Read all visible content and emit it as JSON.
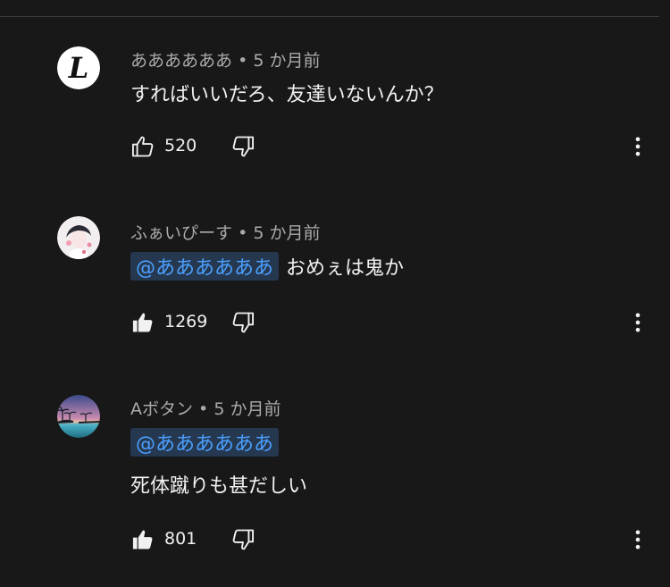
{
  "comments": [
    {
      "author": "ああああああ",
      "separator": "•",
      "time": "5 か月前",
      "mention": "",
      "text": "すればいいだろ、友達いないんか？",
      "likes": "520",
      "liked": false
    },
    {
      "author": "ふぁいぴーす",
      "separator": "•",
      "time": "5 か月前",
      "mention": "@ああああああ",
      "text": "おめぇは鬼か",
      "likes": "1269",
      "liked": true
    },
    {
      "author": "Aボタン",
      "separator": "•",
      "time": "5 か月前",
      "mention": "@ああああああ",
      "text": "死体蹴りも甚だしい",
      "likes": "801",
      "liked": true
    }
  ],
  "avatar_logo_letter": "L",
  "icons": {
    "like": "thumbs-up-icon",
    "dislike": "thumbs-down-icon",
    "more": "more-vertical-icon"
  },
  "colors": {
    "background": "#181818",
    "text": "#f1f1f1",
    "meta": "#aaaaaa",
    "mention": "#4aa0ff"
  }
}
